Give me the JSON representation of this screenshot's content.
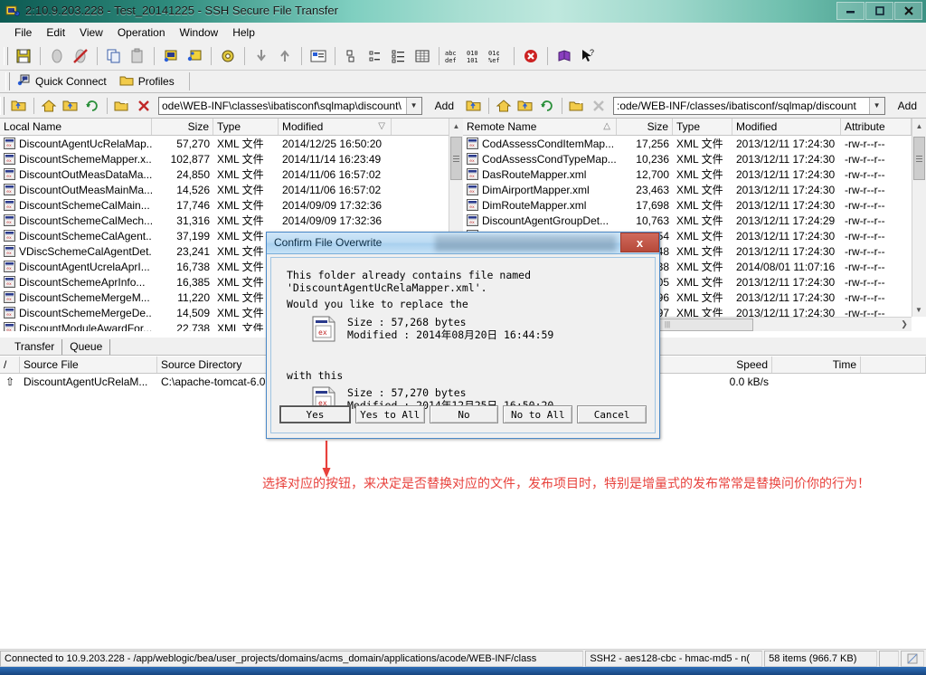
{
  "window": {
    "title": "2:10.9.203.228 - Test_20141225 - SSH Secure File Transfer",
    "minimize": "—",
    "maximize": "❐",
    "close": "✕"
  },
  "menu": {
    "items": [
      "File",
      "Edit",
      "View",
      "Operation",
      "Window",
      "Help"
    ]
  },
  "toolbar": {
    "icons": [
      "save-icon",
      "disconnect-icon",
      "connect-disabled-icon",
      "copy-icon",
      "paste-icon",
      "new-file-transfer-icon",
      "new-terminal-icon",
      "settings-icon",
      "download-icon",
      "upload-icon",
      "properties-icon",
      "list-large-icons-icon",
      "list-small-icons-icon",
      "list-details-icon",
      "list-report-icon",
      "ascii-transfer-icon",
      "binary-transfer-icon",
      "auto-transfer-icon",
      "abort-icon",
      "help-book-icon",
      "context-help-icon"
    ]
  },
  "quickbar": {
    "quick_connect": "Quick Connect",
    "profiles": "Profiles"
  },
  "local_panel": {
    "path": "ode\\WEB-INF\\classes\\ibatisconf\\sqlmap\\discount\\",
    "add_label": "Add",
    "columns": [
      "Local Name",
      "Size",
      "Type",
      "Modified"
    ],
    "sort_column": "Modified",
    "rows": [
      {
        "name": "DiscountAgentUcRelaMap...",
        "size": "57,270",
        "type": "XML 文件",
        "modified": "2014/12/25 16:50:20"
      },
      {
        "name": "DiscountSchemeMapper.x...",
        "size": "102,877",
        "type": "XML 文件",
        "modified": "2014/11/14 16:23:49"
      },
      {
        "name": "DiscountOutMeasDataMa...",
        "size": "24,850",
        "type": "XML 文件",
        "modified": "2014/11/06 16:57:02"
      },
      {
        "name": "DiscountOutMeasMainMa...",
        "size": "14,526",
        "type": "XML 文件",
        "modified": "2014/11/06 16:57:02"
      },
      {
        "name": "DiscountSchemeCalMain...",
        "size": "17,746",
        "type": "XML 文件",
        "modified": "2014/09/09 17:32:36"
      },
      {
        "name": "DiscountSchemeCalMech...",
        "size": "31,316",
        "type": "XML 文件",
        "modified": "2014/09/09 17:32:36"
      },
      {
        "name": "DiscountSchemeCalAgent...",
        "size": "37,199",
        "type": "XML 文件",
        "modified": ""
      },
      {
        "name": "VDiscSchemeCalAgentDet...",
        "size": "23,241",
        "type": "XML 文件",
        "modified": ""
      },
      {
        "name": "DiscountAgentUcrelaAprI...",
        "size": "16,738",
        "type": "XML 文件",
        "modified": ""
      },
      {
        "name": "DiscountSchemeAprInfo...",
        "size": "16,385",
        "type": "XML 文件",
        "modified": ""
      },
      {
        "name": "DiscountSchemeMergeM...",
        "size": "11,220",
        "type": "XML 文件",
        "modified": ""
      },
      {
        "name": "DiscountSchemeMergeDe...",
        "size": "14,509",
        "type": "XML 文件",
        "modified": ""
      },
      {
        "name": "DiscountModuleAwardFor...",
        "size": "22,738",
        "type": "XML 文件",
        "modified": ""
      }
    ]
  },
  "remote_panel": {
    "path": ":ode/WEB-INF/classes/ibatisconf/sqlmap/discount",
    "add_label": "Add",
    "columns": [
      "Remote Name",
      "Size",
      "Type",
      "Modified",
      "Attribute"
    ],
    "sort_column": "Remote Name",
    "rows": [
      {
        "name": "CodAssessCondItemMap...",
        "size": "17,256",
        "type": "XML 文件",
        "modified": "2013/12/11 17:24:30",
        "attr": "-rw-r--r--"
      },
      {
        "name": "CodAssessCondTypeMap...",
        "size": "10,236",
        "type": "XML 文件",
        "modified": "2013/12/11 17:24:30",
        "attr": "-rw-r--r--"
      },
      {
        "name": "DasRouteMapper.xml",
        "size": "12,700",
        "type": "XML 文件",
        "modified": "2013/12/11 17:24:30",
        "attr": "-rw-r--r--"
      },
      {
        "name": "DimAirportMapper.xml",
        "size": "23,463",
        "type": "XML 文件",
        "modified": "2013/12/11 17:24:30",
        "attr": "-rw-r--r--"
      },
      {
        "name": "DimRouteMapper.xml",
        "size": "17,698",
        "type": "XML 文件",
        "modified": "2013/12/11 17:24:30",
        "attr": "-rw-r--r--"
      },
      {
        "name": "DiscountAgentGroupDet...",
        "size": "10,763",
        "type": "XML 文件",
        "modified": "2013/12/11 17:24:29",
        "attr": "-rw-r--r--"
      },
      {
        "name": "",
        "size": "2,654",
        "type": "XML 文件",
        "modified": "2013/12/11 17:24:30",
        "attr": "-rw-r--r--"
      },
      {
        "name": "",
        "size": "6,248",
        "type": "XML 文件",
        "modified": "2013/12/11 17:24:30",
        "attr": "-rw-r--r--"
      },
      {
        "name": "",
        "size": "6,738",
        "type": "XML 文件",
        "modified": "2014/08/01 11:07:16",
        "attr": "-rw-r--r--"
      },
      {
        "name": "",
        "size": "3,805",
        "type": "XML 文件",
        "modified": "2013/12/11 17:24:30",
        "attr": "-rw-r--r--"
      },
      {
        "name": "",
        "size": ",996",
        "type": "XML 文件",
        "modified": "2013/12/11 17:24:30",
        "attr": "-rw-r--r--"
      },
      {
        "name": "",
        "size": "997",
        "type": "XML 文件",
        "modified": "2013/12/11 17:24:30",
        "attr": "-rw-r--r--"
      }
    ]
  },
  "transfer": {
    "tabs": [
      "Transfer",
      "Queue"
    ],
    "columns": [
      "/",
      "Source File",
      "Source Directory",
      "Speed",
      "Time"
    ],
    "rows": [
      {
        "dir": "⇧",
        "source_file": "DiscountAgentUcRelaM...",
        "source_dir": "C:\\apache-tomcat-6.0",
        "speed": "0.0 kB/s",
        "time": ""
      }
    ]
  },
  "dialog": {
    "title": "Confirm File Overwrite",
    "close": "x",
    "line1": "This folder already contains file named\n'DiscountAgentUcRelaMapper.xml'.",
    "line2": "Would you like to replace the",
    "line3": "with this",
    "old_file": {
      "size_label": "Size : 57,268 bytes",
      "modified_label": "Modified : 2014年08月20日 16:44:59"
    },
    "new_file": {
      "size_label": "Size : 57,270 bytes",
      "modified_label": "Modified : 2014年12月25日 16:50:20"
    },
    "buttons": [
      "Yes",
      "Yes to All",
      "No",
      "No to All",
      "Cancel"
    ]
  },
  "annotation": {
    "text": "选择对应的按钮，来决定是否替换对应的文件，发布项目时，特别是增量式的发布常常是替换问价你的行为！",
    "color": "#e8413c"
  },
  "statusbar": {
    "connection": "Connected to 10.9.203.228 - /app/weblogic/bea/user_projects/domains/acms_domain/applications/acode/WEB-INF/class",
    "cipher": "SSH2 - aes128-cbc - hmac-md5 - n(",
    "items": "58 items (966.7 KB)"
  }
}
